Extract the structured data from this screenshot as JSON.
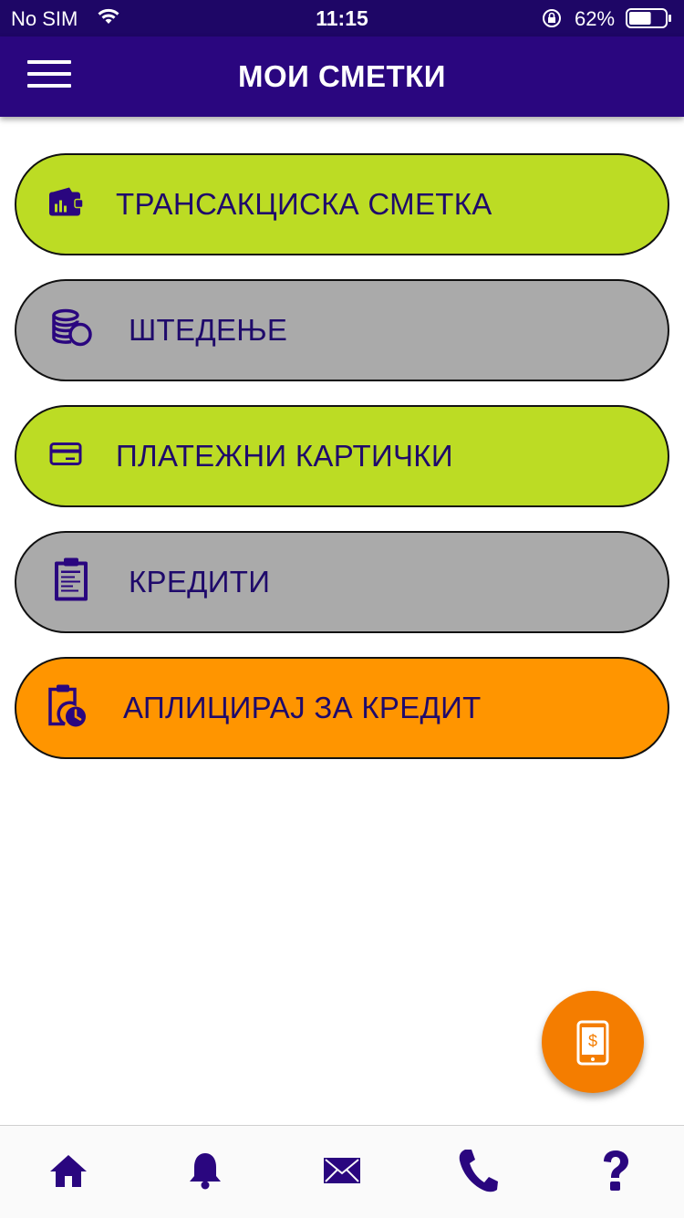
{
  "status_bar": {
    "carrier": "No SIM",
    "time": "11:15",
    "battery_percent": "62%",
    "battery_level": 0.62
  },
  "header": {
    "title": "МОИ СМЕТКИ",
    "menu_icon": "hamburger-icon"
  },
  "accounts": [
    {
      "label": "ТРАНСАКЦИСКА СМЕТКА",
      "icon": "wallet-icon",
      "color": "#bcdc24"
    },
    {
      "label": "ШТЕДЕЊЕ",
      "icon": "coins-icon",
      "color": "#aaaaaa"
    },
    {
      "label": "ПЛАТЕЖНИ КАРТИЧКИ",
      "icon": "card-icon",
      "color": "#bcdc24"
    },
    {
      "label": "КРЕДИТИ",
      "icon": "clipboard-icon",
      "color": "#aaaaaa"
    },
    {
      "label": "АПЛИЦИРАЈ ЗА КРЕДИТ",
      "icon": "clipboard-clock-icon",
      "color": "#ff9500"
    }
  ],
  "fab": {
    "icon": "mobile-payment-icon",
    "color": "#f47d00"
  },
  "bottom_nav": [
    {
      "icon": "home-icon"
    },
    {
      "icon": "bell-icon"
    },
    {
      "icon": "envelope-icon"
    },
    {
      "icon": "phone-icon"
    },
    {
      "icon": "question-icon"
    }
  ],
  "colors": {
    "brand_dark": "#2a067f",
    "icon_purple": "#2a067f",
    "label_text": "#1f0a6b"
  }
}
